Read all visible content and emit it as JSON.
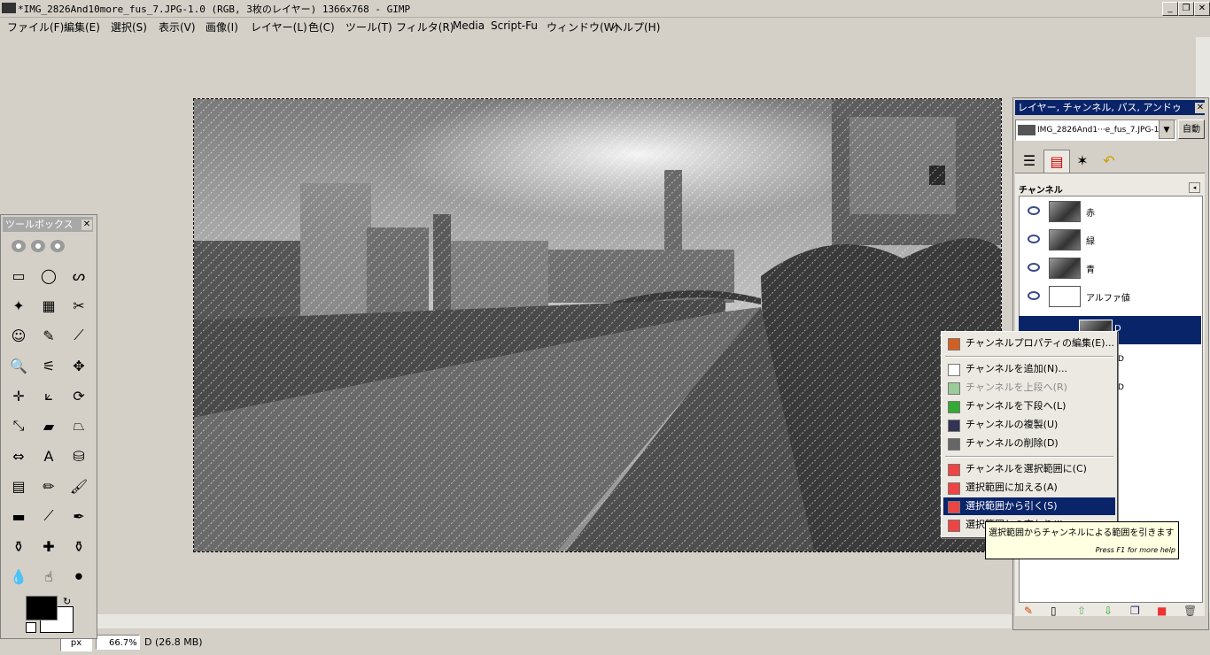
{
  "window": {
    "title": "*IMG_2826And10more_fus_7.JPG-1.0 (RGB, 3枚のレイヤー) 1366x768 - GIMP",
    "minimize": "_",
    "restore": "❐",
    "close": "✕"
  },
  "menubar": [
    "ファイル(F)",
    "編集(E)",
    "選択(S)",
    "表示(V)",
    "画像(I)",
    "レイヤー(L)",
    "色(C)",
    "ツール(T)",
    "フィルタ(R)",
    "Media",
    "Script-Fu",
    "ウィンドウ(W)",
    "ヘルプ(H)"
  ],
  "toolbox": {
    "title": "ツールボックス",
    "close": "✕",
    "tools": [
      {
        "name": "rect-select-icon",
        "glyph": "▭"
      },
      {
        "name": "ellipse-select-icon",
        "glyph": "◯"
      },
      {
        "name": "free-select-icon",
        "glyph": "ᔕ"
      },
      {
        "name": "fuzzy-select-icon",
        "glyph": "✦"
      },
      {
        "name": "select-by-color-icon",
        "glyph": "▦"
      },
      {
        "name": "scissors-icon",
        "glyph": "✂"
      },
      {
        "name": "foreground-select-icon",
        "glyph": "☺"
      },
      {
        "name": "paths-icon",
        "glyph": "✎"
      },
      {
        "name": "color-picker-icon",
        "glyph": "⟋"
      },
      {
        "name": "zoom-icon",
        "glyph": "🔍"
      },
      {
        "name": "measure-icon",
        "glyph": "⚟"
      },
      {
        "name": "move-icon",
        "glyph": "✥"
      },
      {
        "name": "align-icon",
        "glyph": "✛"
      },
      {
        "name": "crop-icon",
        "glyph": "⟀"
      },
      {
        "name": "rotate-icon",
        "glyph": "⟳"
      },
      {
        "name": "scale-icon",
        "glyph": "⤡"
      },
      {
        "name": "shear-icon",
        "glyph": "▰"
      },
      {
        "name": "perspective-icon",
        "glyph": "⏢"
      },
      {
        "name": "flip-icon",
        "glyph": "⇔"
      },
      {
        "name": "text-icon",
        "glyph": "A"
      },
      {
        "name": "bucket-fill-icon",
        "glyph": "⛁"
      },
      {
        "name": "blend-icon",
        "glyph": "▤"
      },
      {
        "name": "pencil-icon",
        "glyph": "✏"
      },
      {
        "name": "paintbrush-icon",
        "glyph": "🖌"
      },
      {
        "name": "eraser-icon",
        "glyph": "▬"
      },
      {
        "name": "airbrush-icon",
        "glyph": "⟋"
      },
      {
        "name": "ink-icon",
        "glyph": "✒"
      },
      {
        "name": "clone-icon",
        "glyph": "⚱"
      },
      {
        "name": "heal-icon",
        "glyph": "✚"
      },
      {
        "name": "perspective-clone-icon",
        "glyph": "⚱"
      },
      {
        "name": "blur-icon",
        "glyph": "💧"
      },
      {
        "name": "smudge-icon",
        "glyph": "☝"
      },
      {
        "name": "dodge-burn-icon",
        "glyph": "⚫"
      }
    ]
  },
  "statusbar": {
    "unit": "px",
    "zoom": "66.7%",
    "info": "D (26.8 MB)"
  },
  "dock": {
    "title": "レイヤー, チャンネル, パス, アンドゥ",
    "close": "✕",
    "image_selector": "IMG_2826And1···e_fus_7.JPG-1",
    "auto_button": "自動",
    "section_title": "チャンネル",
    "channels": [
      {
        "label": "赤"
      },
      {
        "label": "緑"
      },
      {
        "label": "青"
      },
      {
        "label": "アルファ値"
      }
    ],
    "selected_channel_label": "D",
    "hidden_labels": [
      "D",
      "D"
    ]
  },
  "context_menu": {
    "items": [
      {
        "label": "チャンネルプロパティの編集(E)...",
        "icon": "edit-icon",
        "state": "normal"
      },
      {
        "sep": true
      },
      {
        "label": "チャンネルを追加(N)...",
        "icon": "new-icon",
        "state": "normal"
      },
      {
        "label": "チャンネルを上段へ(R)",
        "icon": "up-arrow-icon",
        "state": "disabled"
      },
      {
        "label": "チャンネルを下段へ(L)",
        "icon": "down-arrow-icon",
        "state": "normal"
      },
      {
        "label": "チャンネルの複製(U)",
        "icon": "duplicate-icon",
        "state": "normal"
      },
      {
        "label": "チャンネルの削除(D)",
        "icon": "trash-icon",
        "state": "normal"
      },
      {
        "sep": true
      },
      {
        "label": "チャンネルを選択範囲に(C)",
        "icon": "channel-to-selection-icon",
        "state": "normal"
      },
      {
        "label": "選択範囲に加える(A)",
        "icon": "selection-add-icon",
        "state": "normal"
      },
      {
        "label": "選択範囲から引く(S)",
        "icon": "selection-subtract-icon",
        "state": "selected"
      },
      {
        "label": "選択範囲との交わり(I)",
        "icon": "selection-intersect-icon",
        "state": "normal"
      }
    ]
  },
  "tooltip": {
    "text": "選択範囲からチャンネルによる範囲を引きます",
    "help": "Press F1 for more help"
  },
  "colors": {
    "selection": "#0a246a",
    "background": "#d4d0c8",
    "foreground_swatch": "#000000",
    "background_swatch": "#ffffff"
  }
}
